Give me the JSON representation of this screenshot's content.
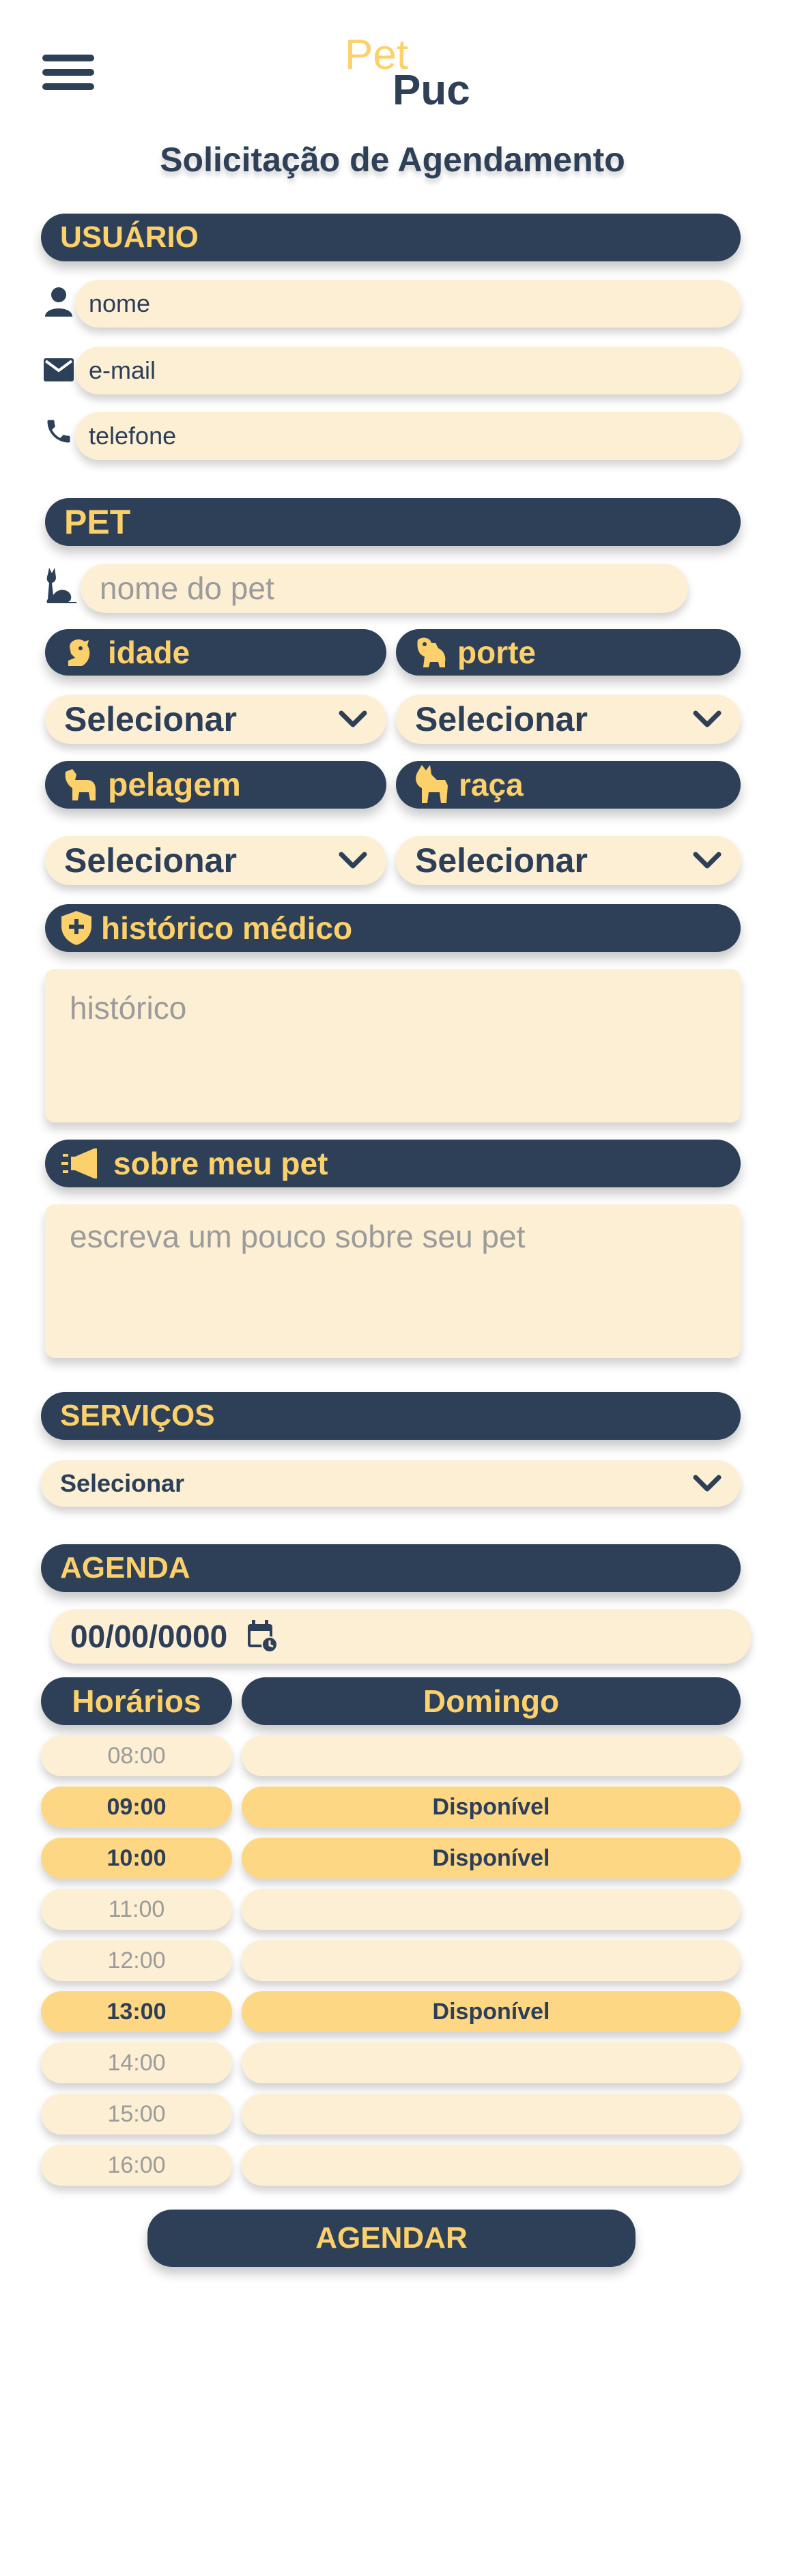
{
  "header": {
    "logo_pet": "Pet",
    "logo_puc": "Puc",
    "page_title": "Solicitação de Agendamento"
  },
  "usuario": {
    "section_label": "USUÁRIO",
    "name_value": "nome",
    "email_value": "e-mail",
    "phone_value": "telefone"
  },
  "pet": {
    "section_label": "PET",
    "name_placeholder": "nome do pet",
    "idade_label": "idade",
    "porte_label": "porte",
    "pelagem_label": "pelagem",
    "raca_label": "raça",
    "select_default": "Selecionar",
    "historico_label": "histórico médico",
    "historico_placeholder": "histórico",
    "sobre_label": "sobre meu pet",
    "sobre_placeholder": "escreva um pouco sobre seu pet"
  },
  "servicos": {
    "section_label": "SERVIÇOS",
    "select_default": "Selecionar"
  },
  "agenda": {
    "section_label": "AGENDA",
    "date_value": "00/00/0000",
    "col_horarios": "Horários",
    "col_day": "Domingo",
    "slots": [
      {
        "time": "08:00",
        "status": "",
        "available": false
      },
      {
        "time": "09:00",
        "status": "Disponível",
        "available": true
      },
      {
        "time": "10:00",
        "status": "Disponível",
        "available": true
      },
      {
        "time": "11:00",
        "status": "",
        "available": false
      },
      {
        "time": "12:00",
        "status": "",
        "available": false
      },
      {
        "time": "13:00",
        "status": "Disponível",
        "available": true
      },
      {
        "time": "14:00",
        "status": "",
        "available": false
      },
      {
        "time": "15:00",
        "status": "",
        "available": false
      },
      {
        "time": "16:00",
        "status": "",
        "available": false
      }
    ]
  },
  "submit_label": "AGENDAR",
  "colors": {
    "navy": "#2e4058",
    "gold": "#fcd06a",
    "cream": "#fcefd3",
    "gold_light": "#fdd784"
  }
}
